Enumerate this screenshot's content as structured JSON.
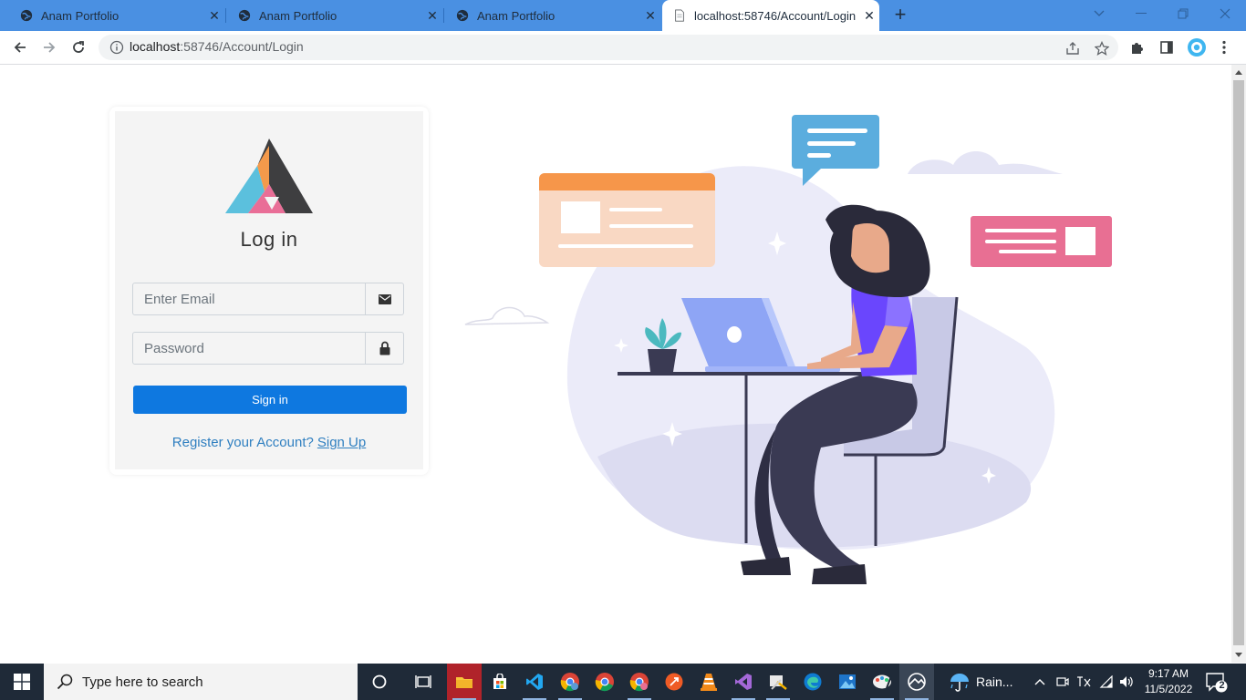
{
  "browser": {
    "tabs": [
      {
        "title": "Anam Portfolio",
        "active": false
      },
      {
        "title": "Anam Portfolio",
        "active": false
      },
      {
        "title": "Anam Portfolio",
        "active": false
      },
      {
        "title": "localhost:58746/Account/Login",
        "active": true
      }
    ],
    "url_host": "localhost",
    "url_path": ":58746/Account/Login"
  },
  "login": {
    "title": "Log in",
    "email_placeholder": "Enter Email",
    "password_placeholder": "Password",
    "signin_label": "Sign in",
    "register_text": "Register your Account?",
    "signup_label": "Sign Up"
  },
  "taskbar": {
    "search_placeholder": "Type here to search",
    "weather": "Rain...",
    "time": "9:17 AM",
    "date": "11/5/2022",
    "notification_count": "2"
  },
  "colors": {
    "tabstrip": "#4a90e2",
    "primary_button": "#0e78e0",
    "link": "#2f7fc0",
    "taskbar": "#1f2a38"
  }
}
